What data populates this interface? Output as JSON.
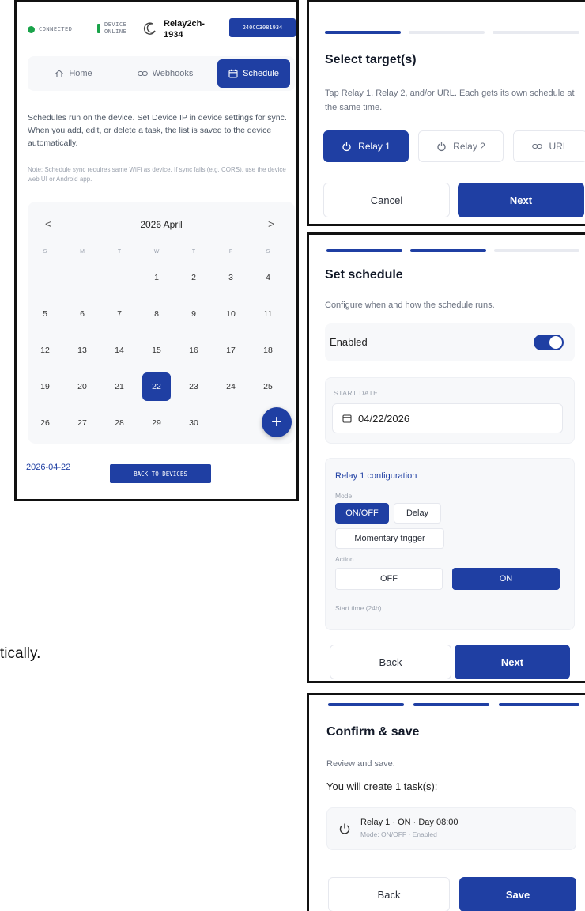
{
  "background_text": "tically.",
  "panel1": {
    "status": {
      "connected_label": "CONNECTED",
      "device_label_line1": "DEVICE",
      "device_label_line2": "ONLINE",
      "device_name_line1": "Relay2ch-",
      "device_name_line2": "1934",
      "device_id": "240CC3081934"
    },
    "tabs": [
      {
        "label": "Home",
        "icon": "home-icon"
      },
      {
        "label": "Webhooks",
        "icon": "link-icon"
      },
      {
        "label": "Schedule",
        "icon": "calendar-icon",
        "active": true
      }
    ],
    "description": "Schedules run on the device. Set Device IP in device settings for sync. When you add, edit, or delete a task, the list is saved to the device automatically.",
    "note": "Note: Schedule sync requires same WiFi as device. If sync fails (e.g. CORS), use the device web UI or Android app.",
    "calendar": {
      "month_label": "2026 April",
      "prev": "<",
      "next": ">",
      "weekdays": [
        "S",
        "M",
        "T",
        "W",
        "T",
        "F",
        "S"
      ],
      "first_weekday": 3,
      "days": 30,
      "selected": 22
    },
    "add_button": "+",
    "selected_date": "2026-04-22",
    "back_button": "BACK TO DEVICES"
  },
  "panel2": {
    "progress": {
      "steps": 3,
      "current": 1
    },
    "title": "Select target(s)",
    "description": "Tap Relay 1, Relay 2, and/or URL. Each gets its own schedule at the same time.",
    "targets": [
      {
        "label": "Relay 1",
        "icon": "power-icon",
        "selected": true
      },
      {
        "label": "Relay 2",
        "icon": "power-icon",
        "selected": false
      },
      {
        "label": "URL",
        "icon": "link-icon",
        "selected": false
      }
    ],
    "cancel": "Cancel",
    "next": "Next"
  },
  "panel3": {
    "progress": {
      "steps": 3,
      "current": 2
    },
    "title": "Set schedule",
    "description": "Configure when and how the schedule runs.",
    "enabled_label": "Enabled",
    "enabled": true,
    "start_date_label": "START DATE",
    "start_date": "04/22/2026",
    "relay_config_title": "Relay 1 configuration",
    "mode_label": "Mode",
    "modes": [
      {
        "label": "ON/OFF",
        "selected": true
      },
      {
        "label": "Delay",
        "selected": false
      },
      {
        "label": "Momentary trigger",
        "selected": false
      }
    ],
    "action_label": "Action",
    "actions": [
      {
        "label": "OFF",
        "selected": false
      },
      {
        "label": "ON",
        "selected": true
      }
    ],
    "start_time_label": "Start time (24h)",
    "back": "Back",
    "next": "Next"
  },
  "panel4": {
    "progress": {
      "steps": 3,
      "current": 3
    },
    "title": "Confirm & save",
    "description": "Review and save.",
    "summary": "You will create 1 task(s):",
    "task_title": "Relay 1 · ON · Day 08:00",
    "task_meta": "Mode: ON/OFF · Enabled",
    "back": "Back",
    "save": "Save"
  },
  "colors": {
    "primary": "#1f3fa3",
    "connected": "#1aa34a"
  }
}
